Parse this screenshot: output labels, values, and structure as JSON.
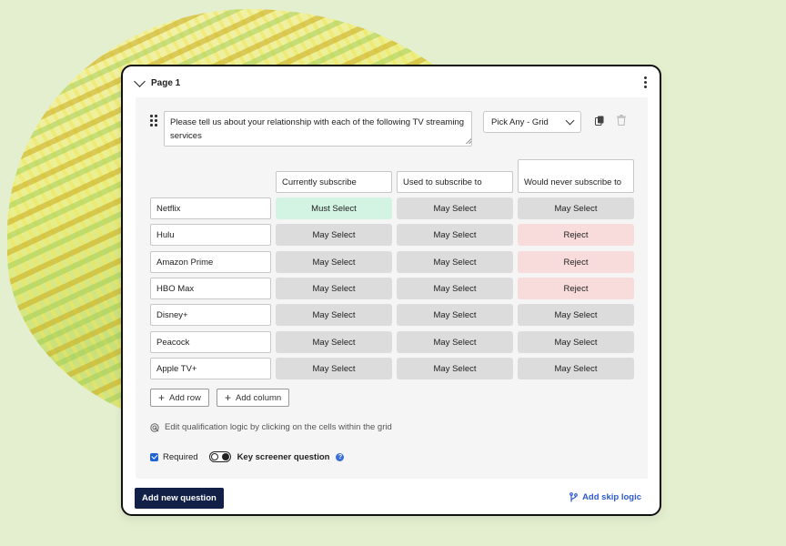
{
  "page": {
    "title": "Page 1"
  },
  "question": {
    "text": "Please tell us about your relationship with each of the following TV streaming services",
    "type": "Pick Any - Grid"
  },
  "grid": {
    "columns": [
      "Currently subscribe",
      "Used to subscribe to",
      "Would never subscribe to"
    ],
    "rows": [
      {
        "label": "Netflix",
        "cells": [
          "Must Select",
          "May Select",
          "May Select"
        ]
      },
      {
        "label": "Hulu",
        "cells": [
          "May Select",
          "May Select",
          "Reject"
        ]
      },
      {
        "label": "Amazon Prime",
        "cells": [
          "May Select",
          "May Select",
          "Reject"
        ]
      },
      {
        "label": "HBO Max",
        "cells": [
          "May Select",
          "May Select",
          "Reject"
        ]
      },
      {
        "label": "Disney+",
        "cells": [
          "May Select",
          "May Select",
          "May Select"
        ]
      },
      {
        "label": "Peacock",
        "cells": [
          "May Select",
          "May Select",
          "May Select"
        ]
      },
      {
        "label": "Apple TV+",
        "cells": [
          "May Select",
          "May Select",
          "May Select"
        ]
      }
    ]
  },
  "actions": {
    "add_row": "Add row",
    "add_column": "Add column",
    "hint": "Edit qualification logic by clicking on the cells within the grid",
    "required_label": "Required",
    "key_screener_label": "Key screener question",
    "add_question": "Add new question",
    "skip_logic": "Add skip logic"
  },
  "colors": {
    "must": "#d3f3e3",
    "may": "#dcdcdc",
    "reject": "#f8dcdc",
    "primary": "#122047",
    "link": "#2d5bd0"
  }
}
